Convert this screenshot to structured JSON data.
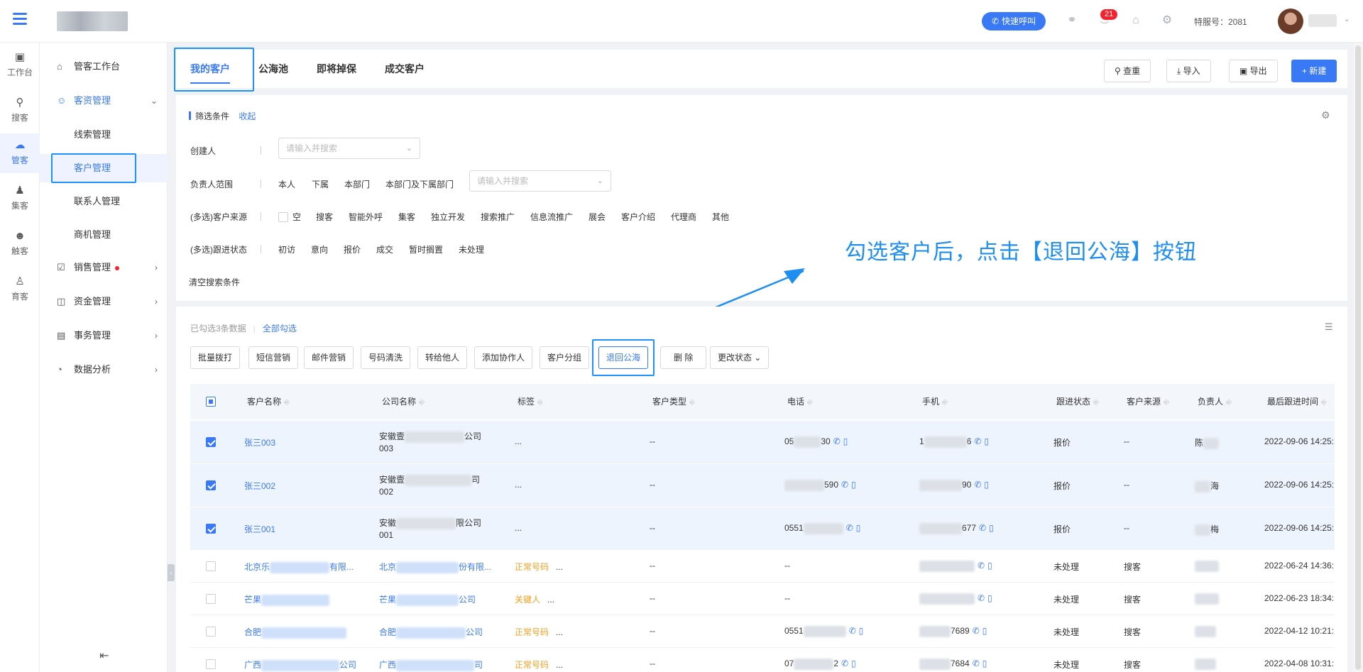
{
  "header": {
    "quick_call": "快速呼叫",
    "badge_count": "21",
    "service_no": "特服号：2081"
  },
  "rail": {
    "items": [
      "工作台",
      "搜客",
      "管客",
      "集客",
      "触客",
      "育客"
    ]
  },
  "sidebar": {
    "workbench": "管客工作台",
    "resource": "客资管理",
    "sub": [
      "线索管理",
      "客户管理",
      "联系人管理",
      "商机管理"
    ],
    "sales": "销售管理",
    "finance": "资金管理",
    "affairs": "事务管理",
    "analytics": "数据分析"
  },
  "tabs": [
    "我的客户",
    "公海池",
    "即将掉保",
    "成交客户"
  ],
  "toolbar": {
    "dedupe": "查重",
    "import": "导入",
    "export": "导出",
    "create": "+ 新建"
  },
  "filters": {
    "title": "筛选条件",
    "collapse": "收起",
    "creator_label": "创建人",
    "creator_placeholder": "请输入并搜索",
    "owner_label": "负责人范围",
    "owner_options": [
      "本人",
      "下属",
      "本部门",
      "本部门及下属部门"
    ],
    "owner_placeholder": "请输入并搜索",
    "source_label": "(多选)客户来源",
    "source_options": [
      "空",
      "搜客",
      "智能外呼",
      "集客",
      "独立开发",
      "搜索推广",
      "信息流推广",
      "展会",
      "客户介绍",
      "代理商",
      "其他"
    ],
    "status_label": "(多选)跟进状态",
    "status_options": [
      "初访",
      "意向",
      "报价",
      "成交",
      "暂时搁置",
      "未处理"
    ],
    "clear": "清空搜索条件"
  },
  "annotation": "勾选客户后，点击【退回公海】按钮",
  "selection": {
    "info": "已勾选3条数据",
    "select_all": "全部勾选"
  },
  "actions": [
    "批量拨打",
    "短信营销",
    "邮件营销",
    "号码清洗",
    "转给他人",
    "添加协作人",
    "客户分组",
    "退回公海",
    "删 除",
    "更改状态"
  ],
  "table": {
    "columns": [
      "客户名称",
      "公司名称",
      "标签",
      "客户类型",
      "电话",
      "手机",
      "跟进状态",
      "客户来源",
      "负责人",
      "最后跟进时间"
    ],
    "rows": [
      {
        "name": "张三003",
        "company_a": "安徽壹",
        "company_b": "公司",
        "company_c": "003",
        "tag": "...",
        "type": "--",
        "phone_a": "05",
        "phone_b": "30",
        "mobile_a": "1",
        "mobile_b": "6",
        "status": "报价",
        "source": "--",
        "owner": "陈",
        "time": "2022-09-06 14:25:"
      },
      {
        "name": "张三002",
        "company_a": "安徽壹",
        "company_b": "司",
        "company_c": "002",
        "tag": "...",
        "type": "--",
        "phone_a": "",
        "phone_b": "590",
        "mobile_a": "",
        "mobile_b": "90",
        "status": "报价",
        "source": "--",
        "owner": "海",
        "time": "2022-09-06 14:25:"
      },
      {
        "name": "张三001",
        "company_a": "安徽",
        "company_b": "限公司",
        "company_c": "001",
        "tag": "...",
        "type": "--",
        "phone_a": "0551",
        "phone_b": "",
        "mobile_a": "",
        "mobile_b": "677",
        "status": "报价",
        "source": "--",
        "owner": "梅",
        "time": "2022-09-06 14:25:"
      },
      {
        "name_a": "北京乐",
        "name_b": "有限...",
        "company_a": "北京",
        "company_b": "份有限...",
        "tag": "正常号码",
        "tag_more": "...",
        "type": "--",
        "phone": "--",
        "status": "未处理",
        "source": "搜客",
        "time": "2022-06-24 14:36:"
      },
      {
        "name_a": "芒果",
        "name_b": "",
        "company_a": "芒果",
        "company_b": "公司",
        "tag": "关键人",
        "tag_more": "...",
        "type": "--",
        "phone": "--",
        "status": "未处理",
        "source": "搜客",
        "time": "2022-06-23 18:34:"
      },
      {
        "name_a": "合肥",
        "name_b": "",
        "company_a": "合肥",
        "company_b": "公司",
        "tag": "正常号码",
        "tag_more": "...",
        "type": "--",
        "phone_a": "0551",
        "mobile_b": "7689",
        "status": "未处理",
        "source": "搜客",
        "time": "2022-04-12 10:21:"
      },
      {
        "name_a": "广西",
        "name_b": "公司",
        "company_a": "广西",
        "company_b": "司",
        "tag": "正常号码",
        "tag_more": "...",
        "type": "--",
        "phone_a": "07",
        "phone_b": "2",
        "mobile_b": "7684",
        "status": "未处理",
        "source": "搜客",
        "time": "2022-04-08 10:31:"
      }
    ]
  },
  "colors": {
    "primary": "#3a79f6",
    "annotation": "#1e8ff0",
    "orange_tag": "#f0a020"
  }
}
